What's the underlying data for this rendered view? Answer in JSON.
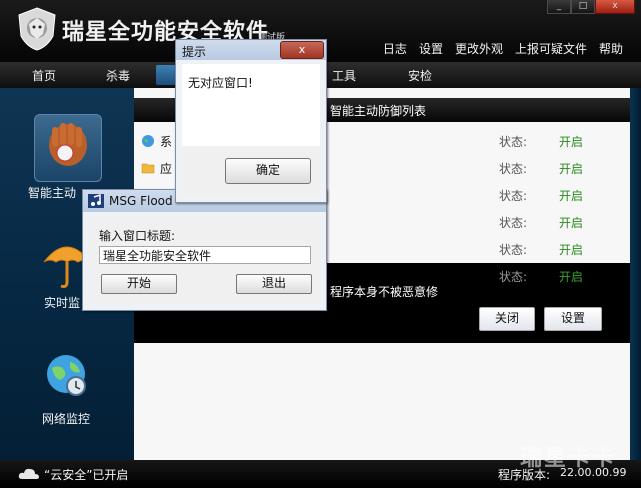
{
  "app": {
    "title": "瑞星全功能安全软件",
    "subtitle": "测试版",
    "window_controls": {
      "minimize": "_",
      "maximize": "□",
      "close": "x"
    }
  },
  "top_menu": [
    "日志",
    "设置",
    "更改外观",
    "上报可疑文件",
    "帮助"
  ],
  "tabs": [
    "首页",
    "杀毒",
    "工具",
    "安检"
  ],
  "sidebar": {
    "items": [
      {
        "label": "智能主动",
        "icon": "baseball-glove-icon"
      },
      {
        "label": "实时监",
        "icon": "umbrella-icon"
      },
      {
        "label": "网络监控",
        "icon": "globe-shield-icon"
      }
    ]
  },
  "panel": {
    "title": "智能主动防御列表",
    "rows": [
      {
        "name": "系",
        "status_label": "状态:",
        "status_value": "开启"
      },
      {
        "name": "应",
        "status_label": "状态:",
        "status_value": "开启"
      },
      {
        "name": "",
        "status_label": "状态:",
        "status_value": "开启"
      },
      {
        "name": "",
        "status_label": "状态:",
        "status_value": "开启"
      },
      {
        "name": "",
        "status_label": "状态:",
        "status_value": "开启"
      },
      {
        "name": "",
        "status_label": "状态:",
        "status_value": "开启"
      }
    ],
    "dark_text": "程序本身不被恶意修",
    "buttons": {
      "close": "关闭",
      "settings": "设置"
    }
  },
  "status_bar": {
    "cloud": "“云安全”已开启",
    "version_label": "程序版本:",
    "version_value": "22.00.00.99"
  },
  "watermark": "瑞星卡卡",
  "alert": {
    "title": "提示",
    "close_glyph": "x",
    "message": "无对应窗口!",
    "ok": "确定"
  },
  "flood": {
    "title": "MSG Flood",
    "label": "输入窗口标题:",
    "input_value": "瑞星全功能安全软件",
    "start": "开始",
    "exit": "退出"
  },
  "colors": {
    "status_on": "#2a8a1e",
    "sidebar_bg": "#062843",
    "close_red": "#a33422"
  }
}
